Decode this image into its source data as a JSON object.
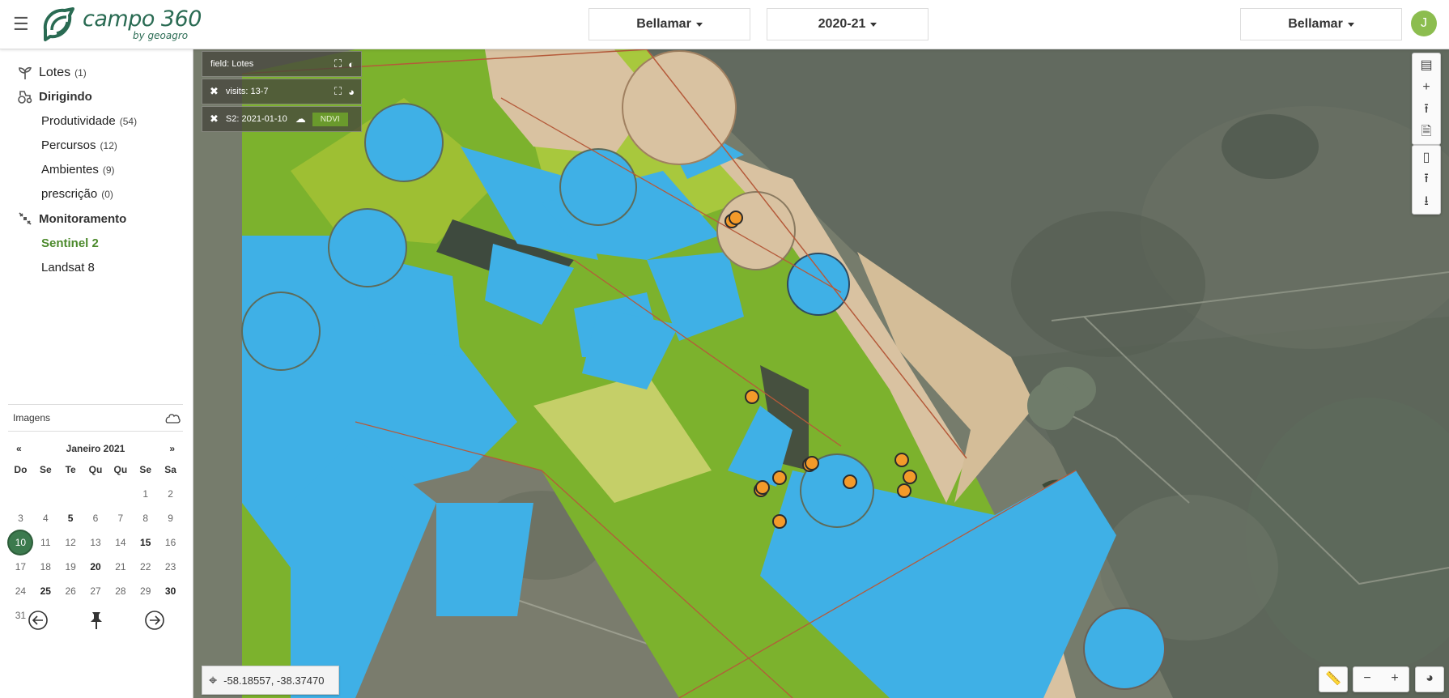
{
  "header": {
    "logo_text": "campo 360",
    "logo_sub": "by geoagro",
    "farm_select": "Bellamar",
    "season_select": "2020-21",
    "account_select": "Bellamar",
    "avatar_initial": "J"
  },
  "sidebar": {
    "lotes": {
      "label": "Lotes",
      "count": "(1)"
    },
    "dirigindo": {
      "label": "Dirigindo"
    },
    "produtividade": {
      "label": "Produtividade",
      "count": "(54)"
    },
    "percursos": {
      "label": "Percursos",
      "count": "(12)"
    },
    "ambientes": {
      "label": "Ambientes",
      "count": "(9)"
    },
    "prescricao": {
      "label": "prescrição",
      "count": "(0)"
    },
    "monitoramento": {
      "label": "Monitoramento"
    },
    "sentinel": {
      "label": "Sentinel 2"
    },
    "landsat": {
      "label": "Landsat 8"
    }
  },
  "images": {
    "label": "Imagens"
  },
  "calendar": {
    "prev": "«",
    "next": "»",
    "month": "Janeiro 2021",
    "weekdays": [
      "Do",
      "Se",
      "Te",
      "Qu",
      "Qu",
      "Se",
      "Sa"
    ],
    "weeks": [
      [
        "",
        "",
        "",
        "",
        "",
        "1",
        "2"
      ],
      [
        "3",
        "4",
        "5",
        "6",
        "7",
        "8",
        "9"
      ],
      [
        "10",
        "11",
        "12",
        "13",
        "14",
        "15",
        "16"
      ],
      [
        "17",
        "18",
        "19",
        "20",
        "21",
        "22",
        "23"
      ],
      [
        "24",
        "25",
        "26",
        "27",
        "28",
        "29",
        "30"
      ],
      [
        "31",
        "",
        "",
        "",
        "",
        "",
        ""
      ]
    ],
    "bold_days": [
      "5",
      "15",
      "20",
      "25",
      "30"
    ],
    "selected_day": "10"
  },
  "map": {
    "layers": [
      {
        "label": "field: Lotes"
      },
      {
        "label": "visits: 13-7"
      },
      {
        "label": "S2: 2021-01-10",
        "badge": "NDVI"
      }
    ],
    "coordinates": "-58.18557, -38.37470"
  },
  "colors": {
    "brand": "#2a6b53",
    "active": "#4c8a2c",
    "water": "#3fb0e6",
    "vegetation": "#7cb22d",
    "soil": "#d9c2a1",
    "marker": "#f39a2a"
  }
}
